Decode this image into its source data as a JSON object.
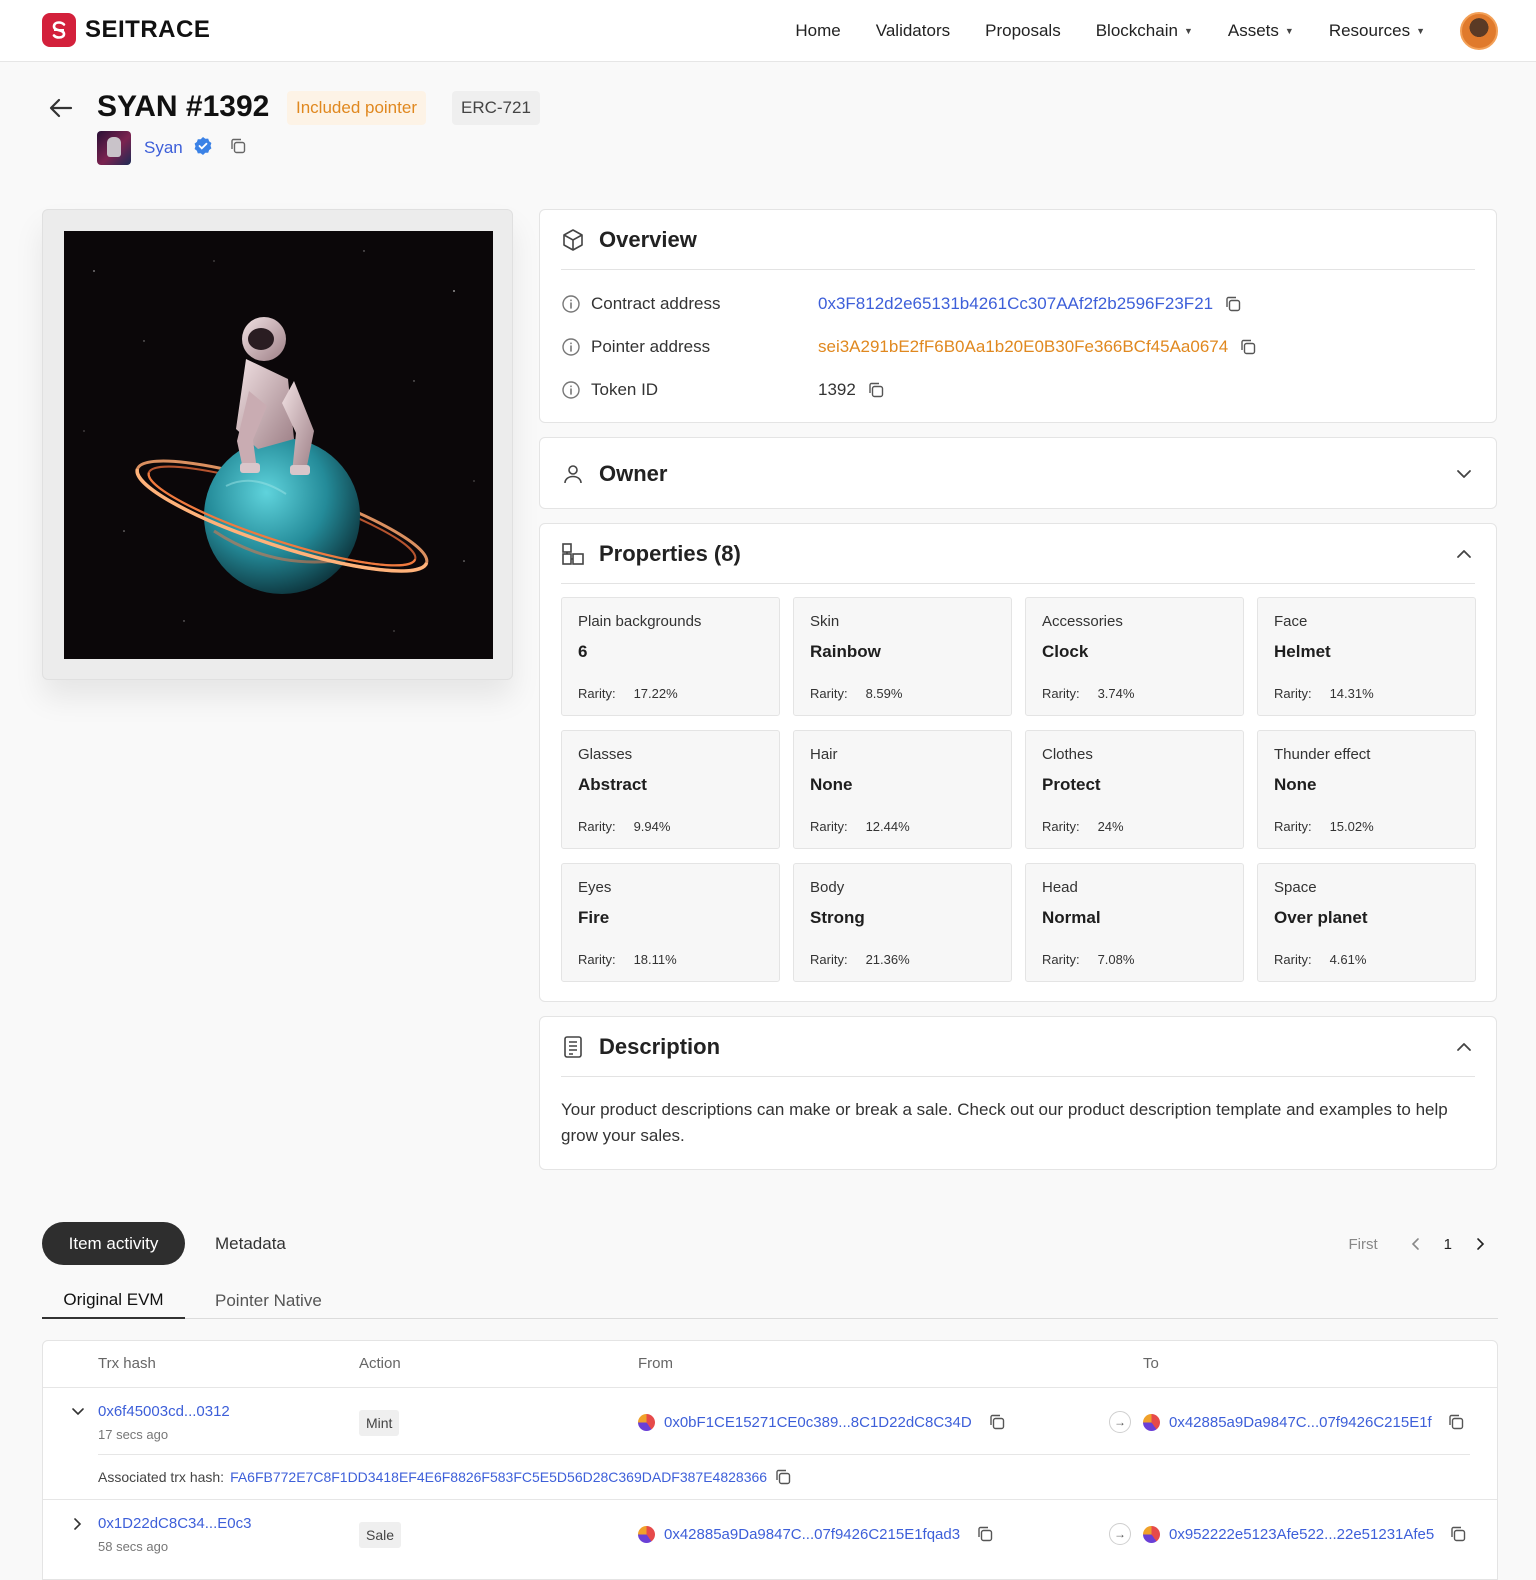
{
  "header": {
    "logo_text": "SEITRACE",
    "nav": [
      {
        "label": "Home",
        "dropdown": false
      },
      {
        "label": "Validators",
        "dropdown": false
      },
      {
        "label": "Proposals",
        "dropdown": false
      },
      {
        "label": "Blockchain",
        "dropdown": true
      },
      {
        "label": "Assets",
        "dropdown": true
      },
      {
        "label": "Resources",
        "dropdown": true
      }
    ]
  },
  "token": {
    "title": "SYAN #1392",
    "pointer_badge": "Included pointer",
    "standard_badge": "ERC-721",
    "collection_name": "Syan"
  },
  "overview": {
    "title": "Overview",
    "contract_label": "Contract address",
    "contract_value": "0x3F812d2e65131b4261Cc307AAf2f2b2596F23F21",
    "pointer_label": "Pointer address",
    "pointer_value": "sei3A291bE2fF6B0Aa1b20E0B30Fe366BCf45Aa0674",
    "token_id_label": "Token ID",
    "token_id_value": "1392"
  },
  "owner": {
    "title": "Owner"
  },
  "properties": {
    "title": "Properties (8)",
    "rarity_label": "Rarity:",
    "items": [
      {
        "name": "Plain backgrounds",
        "value": "6",
        "rarity": "17.22%"
      },
      {
        "name": "Skin",
        "value": "Rainbow",
        "rarity": "8.59%"
      },
      {
        "name": "Accessories",
        "value": "Clock",
        "rarity": "3.74%"
      },
      {
        "name": "Face",
        "value": "Helmet",
        "rarity": "14.31%"
      },
      {
        "name": "Glasses",
        "value": "Abstract",
        "rarity": "9.94%"
      },
      {
        "name": "Hair",
        "value": "None",
        "rarity": "12.44%"
      },
      {
        "name": "Clothes",
        "value": "Protect",
        "rarity": "24%"
      },
      {
        "name": "Thunder effect",
        "value": "None",
        "rarity": "15.02%"
      },
      {
        "name": "Eyes",
        "value": "Fire",
        "rarity": "18.11%"
      },
      {
        "name": "Body",
        "value": "Strong",
        "rarity": "21.36%"
      },
      {
        "name": "Head",
        "value": "Normal",
        "rarity": "7.08%"
      },
      {
        "name": "Space",
        "value": "Over planet",
        "rarity": "4.61%"
      }
    ]
  },
  "description": {
    "title": "Description",
    "text": "Your product descriptions can make or break a sale. Check out our product description template and examples to help grow your sales."
  },
  "activity": {
    "tab_active": "Item activity",
    "tab_other": "Metadata",
    "pager_first": "First",
    "pager_page": "1",
    "subtab_active": "Original EVM",
    "subtab_other": "Pointer Native",
    "columns": [
      "Trx hash",
      "Action",
      "From",
      "To"
    ],
    "rows": [
      {
        "hash": "0x6f45003cd...0312",
        "time": "17 secs ago",
        "action": "Mint",
        "from": "0x0bF1CE15271CE0c389...8C1D22dC8C34D",
        "to": "0x42885a9Da9847C...07f9426C215E1f",
        "expanded": true
      },
      {
        "hash": "0x1D22dC8C34...E0c3",
        "time": "58 secs ago",
        "action": "Sale",
        "from": "0x42885a9Da9847C...07f9426C215E1fqad3",
        "to": "0x952222e5123Afe522...22e51231Afe5",
        "expanded": false
      }
    ],
    "assoc_label": "Associated trx hash:",
    "assoc_value": "FA6FB772E7C8F1DD3418EF4E6F8826F583FC5E5D56D28C369DADF387E4828366"
  }
}
